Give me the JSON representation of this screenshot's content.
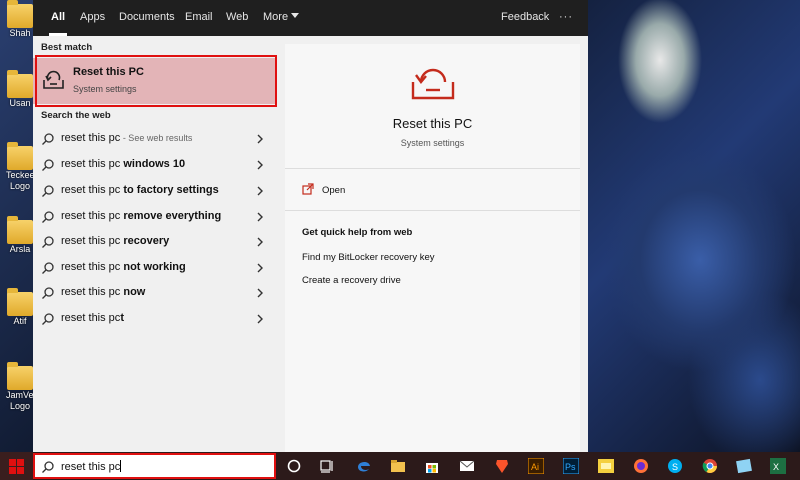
{
  "desktop": {
    "icons": [
      {
        "label": "Shah"
      },
      {
        "label": "Usan"
      },
      {
        "label": "Teckee Logo"
      },
      {
        "label": "Arsla"
      },
      {
        "label": "Atif"
      },
      {
        "label": "JamVer Logo"
      }
    ]
  },
  "tabs": [
    {
      "label": "All"
    },
    {
      "label": "Apps"
    },
    {
      "label": "Documents"
    },
    {
      "label": "Email"
    },
    {
      "label": "Web"
    },
    {
      "label": "More"
    }
  ],
  "feedback_label": "Feedback",
  "more_options_label": "···",
  "best_match": {
    "heading": "Best match",
    "title": "Reset this PC",
    "subtitle": "System settings"
  },
  "search_web": {
    "heading": "Search the web",
    "results": [
      {
        "prefix": "reset this pc",
        "bold": "",
        "suffix": " - See web results"
      },
      {
        "prefix": "reset this pc ",
        "bold": "windows 10",
        "suffix": ""
      },
      {
        "prefix": "reset this pc ",
        "bold": "to factory settings",
        "suffix": ""
      },
      {
        "prefix": "reset this pc ",
        "bold": "remove everything",
        "suffix": ""
      },
      {
        "prefix": "reset this pc ",
        "bold": "recovery",
        "suffix": ""
      },
      {
        "prefix": "reset this pc ",
        "bold": "not working",
        "suffix": ""
      },
      {
        "prefix": "reset this pc ",
        "bold": "now",
        "suffix": ""
      },
      {
        "prefix": "reset this pc",
        "bold": "t",
        "suffix": ""
      }
    ]
  },
  "detail": {
    "title": "Reset this PC",
    "subtitle": "System settings",
    "open_label": "Open",
    "help_heading": "Get quick help from web",
    "links": [
      {
        "label": "Find my BitLocker recovery key"
      },
      {
        "label": "Create a recovery drive"
      }
    ]
  },
  "taskbar": {
    "search_value": "reset this pc",
    "icons": [
      "cortana-icon",
      "task-view-icon",
      "edge-icon",
      "file-explorer-icon",
      "store-icon",
      "mail-icon",
      "brave-icon",
      "illustrator-icon",
      "photoshop-icon",
      "sticky-app-icon",
      "firefox-icon",
      "skype-icon",
      "chrome-icon",
      "pen-app-icon",
      "excel-icon"
    ]
  },
  "colors": {
    "accent_red": "#e01010",
    "best_match_bg": "#e3b4b7",
    "icon_red": "#c42b1c"
  }
}
